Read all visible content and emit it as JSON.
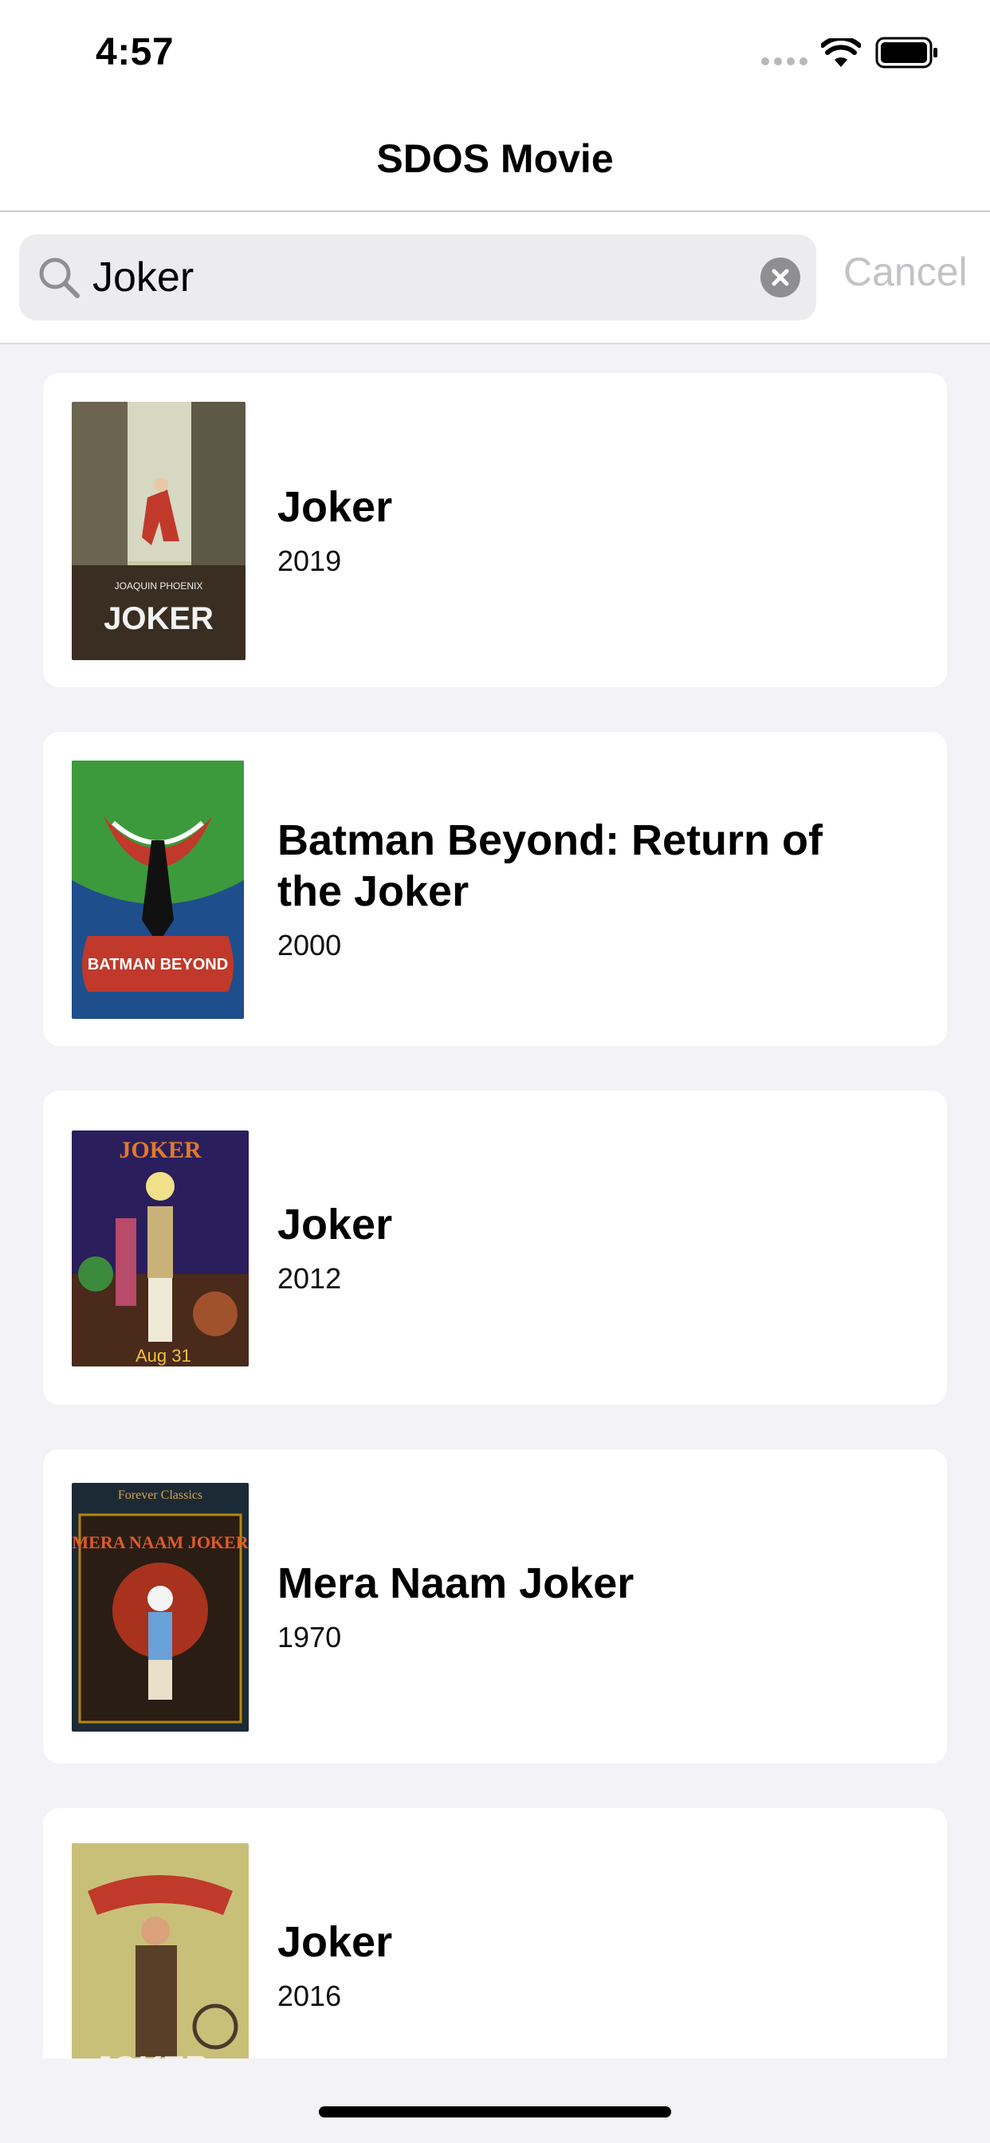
{
  "status_bar": {
    "time": "4:57"
  },
  "nav": {
    "title": "SDOS Movie"
  },
  "search": {
    "query": "Joker",
    "cancel_label": "Cancel"
  },
  "movies": [
    {
      "title": "Joker",
      "year": "2019",
      "poster_caption": "JOKER"
    },
    {
      "title": "Batman Beyond: Return of the Joker",
      "year": "2000",
      "poster_caption": "BATMAN BEYOND"
    },
    {
      "title": "Joker",
      "year": "2012",
      "poster_caption": "JOKER"
    },
    {
      "title": "Mera Naam Joker",
      "year": "1970",
      "poster_caption": "MERA NAAM JOKER"
    },
    {
      "title": "Joker",
      "year": "2016",
      "poster_caption": "JOKER"
    }
  ]
}
